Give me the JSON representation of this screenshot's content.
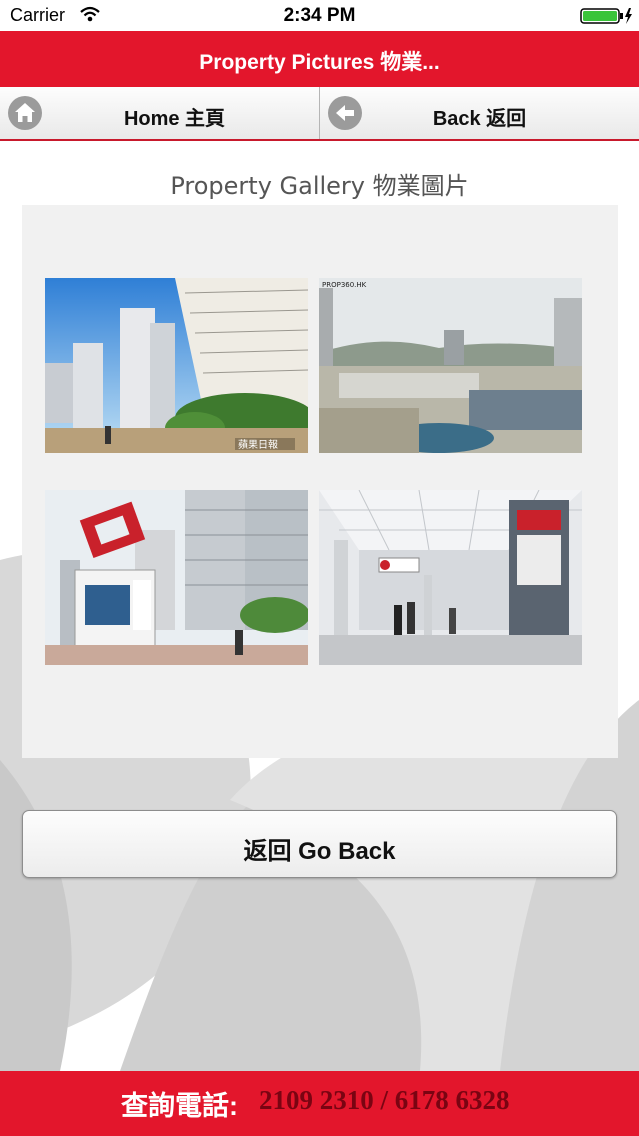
{
  "status_bar": {
    "carrier": "Carrier",
    "time": "2:34 PM",
    "wifi_icon": "wifi-icon",
    "battery_icon": "battery-charging-icon"
  },
  "header": {
    "title": "Property Pictures 物業..."
  },
  "nav": {
    "home_label": "Home 主頁",
    "home_icon": "home-icon",
    "back_label": "Back 返回",
    "back_icon": "arrow-left-icon"
  },
  "gallery": {
    "heading": "Property Gallery 物業圖片",
    "photos": [
      {
        "subject": "residential towers with trees"
      },
      {
        "subject": "aerial view of station and harbour",
        "watermark": "PROP360.HK"
      },
      {
        "subject": "sculpture and estate sign"
      },
      {
        "subject": "MTR station concourse"
      }
    ]
  },
  "go_back": {
    "label": "返回 Go Back"
  },
  "footer": {
    "label": "查詢電話:",
    "phone": "2109 2310 / 6178 6328"
  },
  "colors": {
    "brand_red": "#e3162c",
    "footer_phone": "#7a0412",
    "panel_bg": "#f1f1f1"
  }
}
